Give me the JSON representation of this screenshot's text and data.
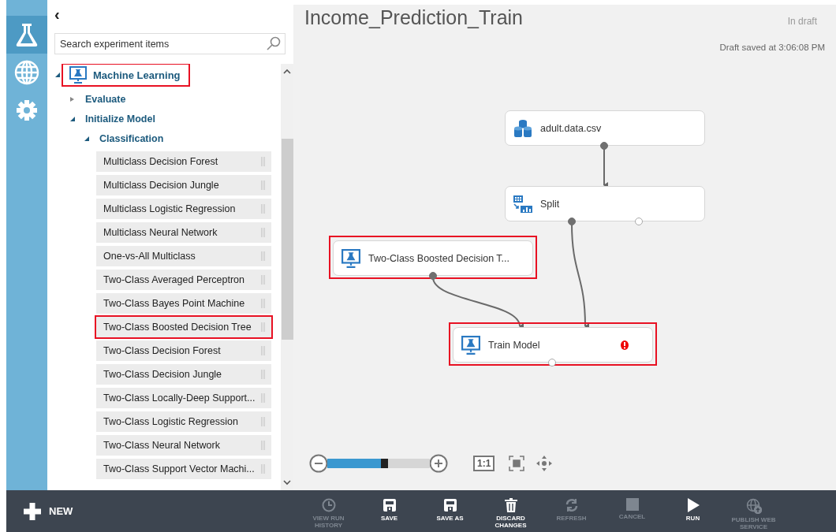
{
  "rail": [
    {
      "kind": "experiments",
      "selected": true
    },
    {
      "kind": "web",
      "selected": false
    },
    {
      "kind": "settings",
      "selected": false
    }
  ],
  "palette": {
    "collapse": "‹",
    "search": {
      "placeholder": "Search experiment items"
    },
    "tree": [
      {
        "label": "Machine Learning",
        "expanded": true,
        "highlighted": true,
        "children": [
          {
            "label": "Evaluate",
            "expanded": false
          },
          {
            "label": "Initialize Model",
            "expanded": true,
            "children": [
              {
                "label": "Classification",
                "expanded": true,
                "modules": [
                  {
                    "label": "Multiclass Decision Forest",
                    "highlighted": false
                  },
                  {
                    "label": "Multiclass Decision Jungle",
                    "highlighted": false
                  },
                  {
                    "label": "Multiclass Logistic Regression",
                    "highlighted": false
                  },
                  {
                    "label": "Multiclass Neural Network",
                    "highlighted": false
                  },
                  {
                    "label": "One-vs-All Multiclass",
                    "highlighted": false
                  },
                  {
                    "label": "Two-Class Averaged Perceptron",
                    "highlighted": false
                  },
                  {
                    "label": "Two-Class Bayes Point Machine",
                    "highlighted": false
                  },
                  {
                    "label": "Two-Class Boosted Decision Tree",
                    "highlighted": true
                  },
                  {
                    "label": "Two-Class Decision Forest",
                    "highlighted": false
                  },
                  {
                    "label": "Two-Class Decision Jungle",
                    "highlighted": false
                  },
                  {
                    "label": "Two-Class Locally-Deep Support...",
                    "highlighted": false
                  },
                  {
                    "label": "Two-Class Logistic Regression",
                    "highlighted": false
                  },
                  {
                    "label": "Two-Class Neural Network",
                    "highlighted": false
                  },
                  {
                    "label": "Two-Class Support Vector Machi...",
                    "highlighted": false
                  }
                ]
              }
            ]
          }
        ]
      }
    ]
  },
  "canvas": {
    "title": "Income_Prediction_Train",
    "status": "In draft",
    "saved": "Draft saved at 3:06:08 PM",
    "nodes": [
      {
        "label": "adult.data.csv",
        "kind": "dataset",
        "highlighted": false,
        "error": false,
        "ports": [
          {
            "connected": true
          }
        ]
      },
      {
        "label": "Split",
        "kind": "split",
        "highlighted": false,
        "error": false,
        "ports": [
          {
            "connected": true
          },
          {
            "connected": false
          }
        ]
      },
      {
        "label": "Two-Class Boosted Decision T...",
        "kind": "model",
        "highlighted": true,
        "error": false,
        "ports": [
          {
            "connected": true
          }
        ]
      },
      {
        "label": "Train Model",
        "kind": "model",
        "highlighted": true,
        "error": true,
        "ports": [
          {
            "connected": false
          }
        ]
      }
    ],
    "zoom": {
      "level": 0.55
    },
    "actual_size": "1:1"
  },
  "bottom_bar": {
    "new_label": "NEW",
    "actions": [
      {
        "label": "VIEW RUN HISTORY",
        "kind": "history",
        "disabled": true
      },
      {
        "label": "SAVE",
        "kind": "save",
        "disabled": false
      },
      {
        "label": "SAVE AS",
        "kind": "save",
        "disabled": false
      },
      {
        "label": "DISCARD CHANGES",
        "kind": "trash",
        "disabled": false
      },
      {
        "label": "REFRESH",
        "kind": "refresh",
        "disabled": true
      },
      {
        "label": "CANCEL",
        "kind": "stop",
        "disabled": true
      },
      {
        "label": "RUN",
        "kind": "run",
        "disabled": false
      },
      {
        "label": "PUBLISH WEB SERVICE",
        "kind": "publish",
        "disabled": true
      }
    ]
  }
}
